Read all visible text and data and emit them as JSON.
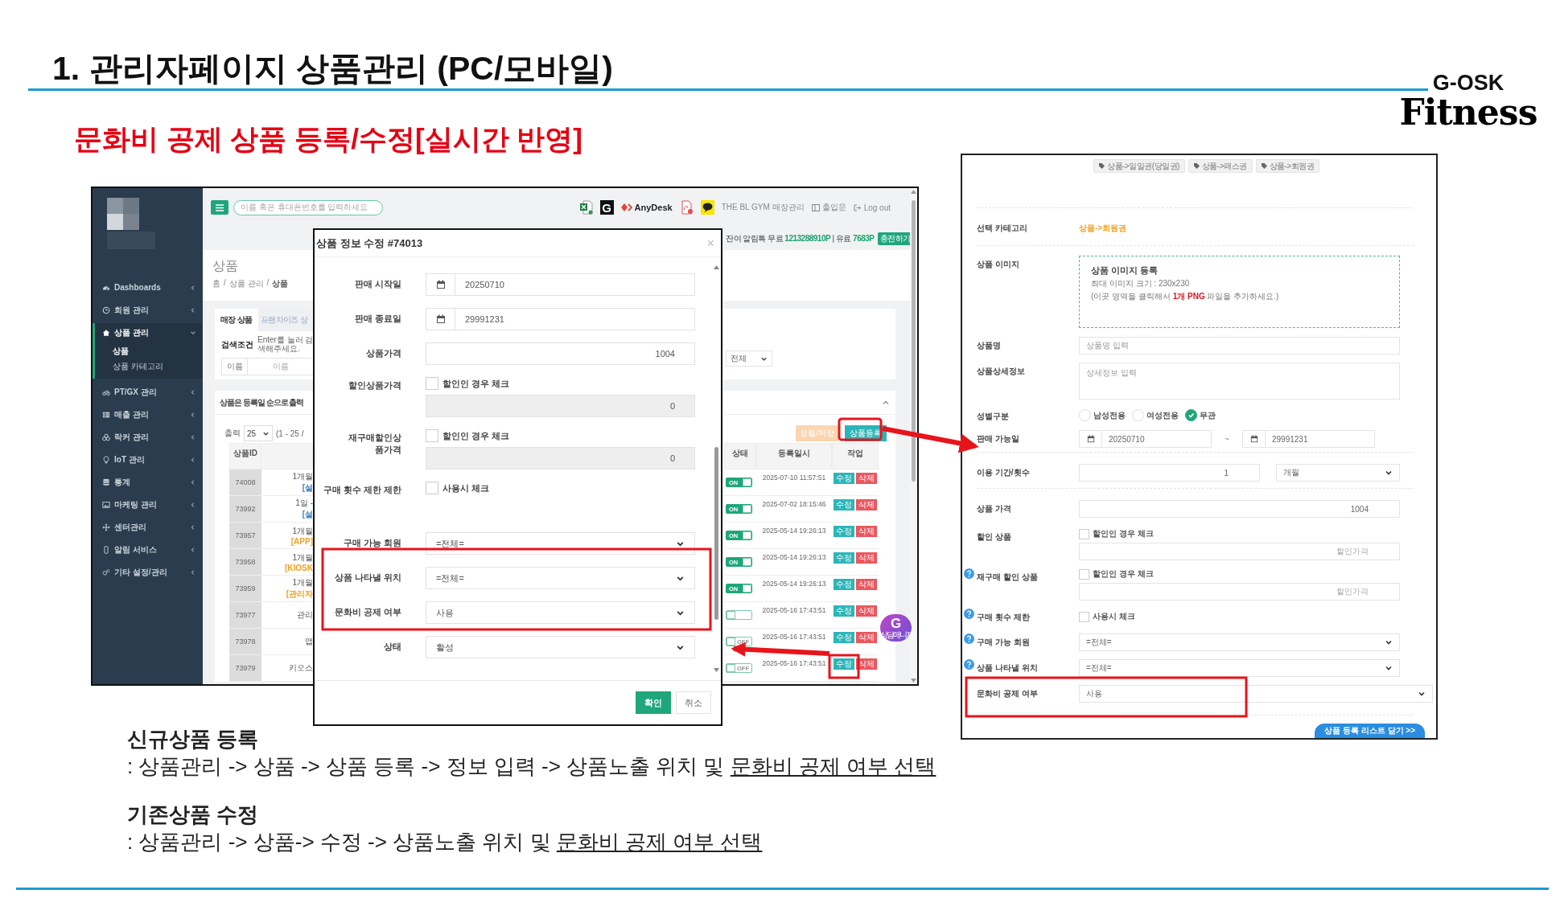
{
  "slide": {
    "title": "1. 관리자페이지 상품관리 (PC/모바일)",
    "subtitle": "문화비 공제 상품 등록/수정[실시간 반영]",
    "logo": {
      "top": "G-OSK",
      "bottom": "Fitness"
    }
  },
  "admin": {
    "search": {
      "placeholder": "이름 혹은 휴대폰번호를 입력하세요"
    },
    "toolbar": {
      "g_app": "G",
      "anydesk": "AnyDesk",
      "store": "THE BL GYM 매장관리",
      "door": "출입문",
      "logout": "Log out"
    },
    "points": {
      "text": "잔여 알림톡 무료 **1213288910P** | 유료 **7683P**",
      "charge": "충전하기"
    },
    "sidebar": [
      {
        "label": "Dashboards",
        "expanded": false,
        "selected": false
      },
      {
        "label": "회원 관리",
        "expanded": false,
        "selected": false
      },
      {
        "label": "상품 관리",
        "expanded": true,
        "selected": true,
        "children": [
          {
            "label": "상품",
            "selected": true
          },
          {
            "label": "상품 카테고리",
            "selected": false
          }
        ]
      },
      {
        "label": "PT/GX 관리",
        "expanded": false,
        "selected": false
      },
      {
        "label": "매출 관리",
        "expanded": false,
        "selected": false
      },
      {
        "label": "락커 관리",
        "expanded": false,
        "selected": false
      },
      {
        "label": "IoT 관리",
        "expanded": false,
        "selected": false
      },
      {
        "label": "통계",
        "expanded": false,
        "selected": false
      },
      {
        "label": "마케팅 관리",
        "expanded": false,
        "selected": false
      },
      {
        "label": "센터관리",
        "expanded": false,
        "selected": false
      },
      {
        "label": "알림 서비스",
        "expanded": false,
        "selected": false
      },
      {
        "label": "기타 설정/관리",
        "expanded": false,
        "selected": false
      }
    ],
    "page_title": "상품",
    "breadcrumb": {
      "separator": "/",
      "items": [
        "홈",
        "상품 관리",
        "상품"
      ]
    },
    "tabs": [
      {
        "label": "매장 상품",
        "selected": true
      },
      {
        "label": "프랜차이즈 상",
        "selected": false
      }
    ],
    "search_panel": {
      "label": "검색조건",
      "hint": "Enter를 눌러 검색해주세요.",
      "field_label": "이름",
      "field_placeholder": "이름",
      "filter_value": "전체"
    },
    "list": {
      "notice": "상품은 등록일 순으로 출력",
      "page_size_label": "출력",
      "page_size": "25",
      "range": "(1 - 25 /",
      "sort_button": "정렬/저장",
      "add_button": "상품등록"
    },
    "table": {
      "columns": [
        "상품ID",
        "상태",
        "등록일시",
        "작업"
      ],
      "rows": [
        {
          "id": "74008",
          "name": "1개월",
          "tag": "[설",
          "color": "#3b7dc4",
          "switch": {
            "on": true,
            "label": "ON"
          },
          "registered": "2025-07-10 11:57:51",
          "actions": [
            "수정",
            "삭제"
          ]
        },
        {
          "id": "73992",
          "name": "1일 -",
          "tag": "[설",
          "color": "#3b7dc4",
          "switch": {
            "on": true,
            "label": "ON"
          },
          "registered": "2025-07-02 18:15:46",
          "actions": [
            "수정",
            "삭제"
          ]
        },
        {
          "id": "73957",
          "name": "1개월",
          "tag": "[APP]",
          "color": "#f0a020",
          "switch": {
            "on": true,
            "label": "ON"
          },
          "registered": "2025-05-14 19:26:13",
          "actions": [
            "수정",
            "삭제"
          ]
        },
        {
          "id": "73958",
          "name": "1개월",
          "tag": "[KIOSK",
          "color": "#f0a020",
          "switch": {
            "on": true,
            "label": "ON"
          },
          "registered": "2025-05-14 19:26:13",
          "actions": [
            "수정",
            "삭제"
          ]
        },
        {
          "id": "73959",
          "name": "1개월",
          "tag": "[관리자",
          "color": "#f0a020",
          "switch": {
            "on": true,
            "label": "ON"
          },
          "registered": "2025-05-14 19:26:13",
          "actions": [
            "수정",
            "삭제"
          ]
        },
        {
          "id": "73977",
          "name": "관리",
          "switch": {
            "on": false
          },
          "registered": "2025-05-16 17:43:51",
          "actions": [
            "수정",
            "삭제"
          ]
        },
        {
          "id": "73978",
          "name": "앱",
          "switch": {
            "on": false,
            "label": "OFF"
          },
          "registered": "2025-05-16 17:43:51",
          "actions": [
            "수정",
            "삭제"
          ]
        },
        {
          "id": "73979",
          "name": "키오스",
          "switch": {
            "on": false,
            "label": "OFF"
          },
          "registered": "2025-05-16 17:43:51",
          "actions": [
            "수정",
            "삭제"
          ]
        }
      ]
    },
    "chat_badge": {
      "letter": "G",
      "label": "상담매니저"
    }
  },
  "edit_dialog": {
    "title": "상품 정보 수정 #74013",
    "close": "×",
    "fields": [
      {
        "kind": "date",
        "label": "판매 시작일",
        "value": "20250710"
      },
      {
        "kind": "date",
        "label": "판매 종료일",
        "value": "29991231"
      },
      {
        "kind": "number",
        "label": "상품가격",
        "value": "1004"
      },
      {
        "kind": "check_number",
        "label": "할인상품가격",
        "check_label": "할인인 경우 체크",
        "checked": false,
        "value": "0",
        "disabled": true
      },
      {
        "kind": "check_number",
        "label": "재구매할인상품가격",
        "check_label": "할인인 경우 체크",
        "checked": false,
        "value": "0",
        "disabled": true
      },
      {
        "kind": "check",
        "label": "구매 횟수 제한 제한",
        "check_label": "사용시 체크",
        "checked": false
      },
      {
        "kind": "select",
        "label": "구매 가능 회원",
        "value": "=전체="
      },
      {
        "kind": "select",
        "label": "상품 나타낼 위치",
        "value": "=전체="
      },
      {
        "kind": "select",
        "label": "문화비 공제 여부",
        "value": "사용"
      },
      {
        "kind": "select",
        "label": "상태",
        "value": "활성"
      }
    ],
    "buttons": [
      {
        "kind": "primary",
        "label": "확인"
      },
      {
        "kind": "default",
        "label": "취소"
      }
    ]
  },
  "register_form": {
    "category_chips": [
      "상품->일일권(당일권)",
      "상품->패스권",
      "상품->회원권"
    ],
    "rows": [
      {
        "kind": "text",
        "label": "선택 카테고리",
        "value": "상품->회원권",
        "divider_above": true
      },
      {
        "kind": "image",
        "label": "상품 이미지",
        "title": "상품 이미지 등록",
        "size": "최대 이미지 크기 : 230x230",
        "hint": "(이곳 영역을 클릭해서 **1개 PNG** 파일을 추가하세요.)",
        "divider_above": true
      },
      {
        "kind": "input",
        "label": "상품명",
        "placeholder": "상품명 입력"
      },
      {
        "kind": "textarea",
        "label": "상품상세정보",
        "placeholder": "상세정보 입력"
      },
      {
        "kind": "radio",
        "label": "성별구분",
        "options": [
          {
            "label": "남성전용",
            "selected": false
          },
          {
            "label": "여성전용",
            "selected": false
          },
          {
            "label": "무관",
            "selected": true
          }
        ]
      },
      {
        "kind": "date_range",
        "label": "판매 가능일",
        "from": "20250710",
        "sep": "~",
        "to": "29991231"
      },
      {
        "kind": "period",
        "label": "이용 기간/횟수",
        "value": "1",
        "unit": "개월",
        "divider_above": true
      },
      {
        "kind": "number",
        "label": "상품 가격",
        "value": "1004",
        "divider_above": true
      },
      {
        "kind": "check_number",
        "label": "할인 상품",
        "check_label": "할인인 경우 체크",
        "checked": false,
        "placeholder": "할인가격"
      },
      {
        "kind": "check_number",
        "label": "재구매 할인 상품",
        "help": true,
        "check_label": "할인인 경우 체크",
        "checked": false,
        "placeholder": "할인가격"
      },
      {
        "kind": "check",
        "label": "구매 횟수 제한",
        "help": true,
        "check_label": "사용시 체크",
        "checked": false
      },
      {
        "kind": "select",
        "label": "구매 가능 회원",
        "help": true,
        "value": "=전체="
      },
      {
        "kind": "select",
        "label": "상품 나타낼 위치",
        "help": true,
        "value": "=전체="
      },
      {
        "kind": "select_wide",
        "label": "문화비 공제 여부",
        "value": "사용"
      }
    ],
    "close_button": "상품 등록 리스트 닫기 >>"
  },
  "notes": [
    {
      "heading": "신규상품 등록",
      "text": ": 상품관리 -> 상품 -> 상품 등록 -> 정보 입력 -> 상품노출 위치 및 ",
      "underlined": "문화비 공제 여부 선택"
    },
    {
      "heading": "기존상품 수정",
      "text": ": 상품관리 -> 상품-> 수정 -> 상품노출 위치 및 ",
      "underlined": "문화비 공제 여부 선택"
    }
  ]
}
